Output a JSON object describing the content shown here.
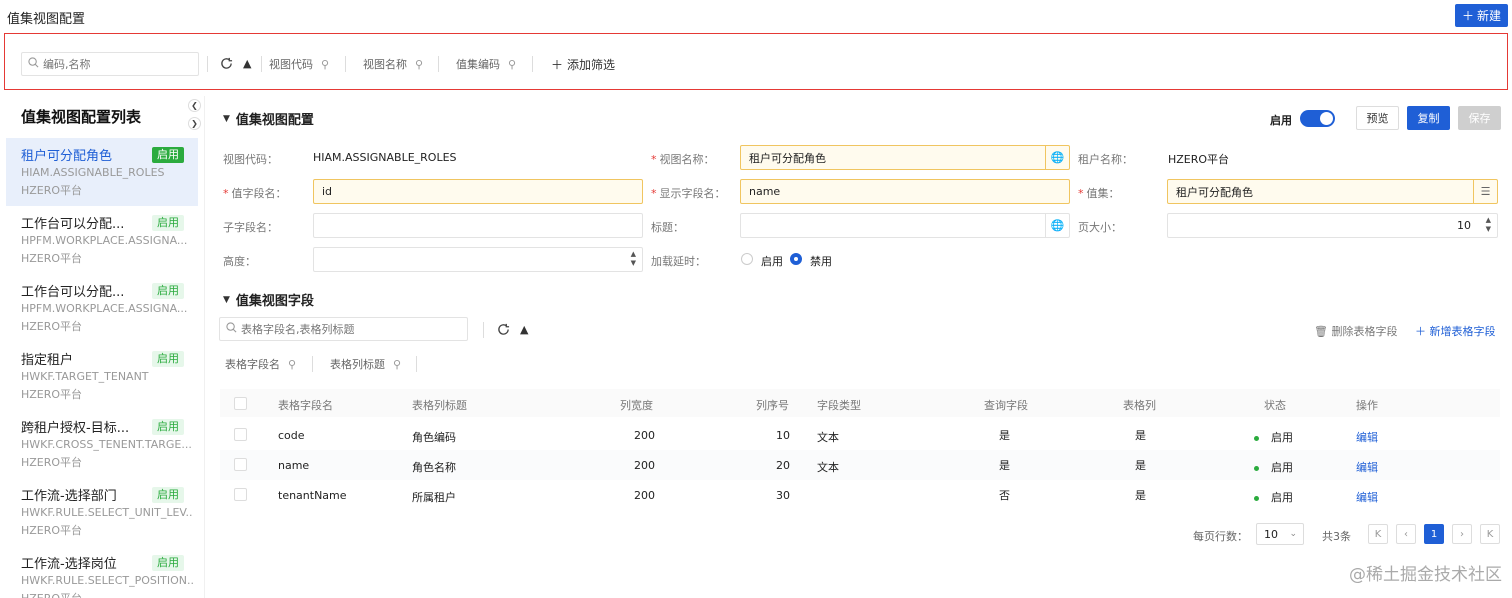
{
  "header": {
    "title": "值集视图配置",
    "new_label": "新建"
  },
  "filter": {
    "search_placeholder": "编码,名称",
    "fields": [
      "视图代码",
      "视图名称",
      "值集编码"
    ],
    "add_filter": "添加筛选"
  },
  "sidebar": {
    "title": "值集视图配置列表",
    "items": [
      {
        "name": "租户可分配角色",
        "code": "HIAM.ASSIGNABLE_ROLES",
        "tenant": "HZERO平台",
        "status": "启用"
      },
      {
        "name": "工作台可以分配...",
        "code": "HPFM.WORKPLACE.ASSIGNA...",
        "tenant": "HZERO平台",
        "status": "启用"
      },
      {
        "name": "工作台可以分配...",
        "code": "HPFM.WORKPLACE.ASSIGNA...",
        "tenant": "HZERO平台",
        "status": "启用"
      },
      {
        "name": "指定租户",
        "code": "HWKF.TARGET_TENANT",
        "tenant": "HZERO平台",
        "status": "启用"
      },
      {
        "name": "跨租户授权-目标...",
        "code": "HWKF.CROSS_TENENT.TARGE...",
        "tenant": "HZERO平台",
        "status": "启用"
      },
      {
        "name": "工作流-选择部门",
        "code": "HWKF.RULE.SELECT_UNIT_LEV...",
        "tenant": "HZERO平台",
        "status": "启用"
      },
      {
        "name": "工作流-选择岗位",
        "code": "HWKF.RULE.SELECT_POSITION...",
        "tenant": "HZERO平台",
        "status": "启用"
      }
    ]
  },
  "config": {
    "section_title": "值集视图配置",
    "enable_label": "启用",
    "preview_label": "预览",
    "copy_label": "复制",
    "save_label": "保存",
    "view_code_label": "视图代码：",
    "view_code": "HIAM.ASSIGNABLE_ROLES",
    "view_name_label": "视图名称：",
    "view_name": "租户可分配角色",
    "tenant_name_label": "租户名称：",
    "tenant_name": "HZERO平台",
    "value_field_label": "值字段名：",
    "value_field": "id",
    "display_field_label": "显示字段名：",
    "display_field": "name",
    "value_set_label": "值集：",
    "value_set": "租户可分配角色",
    "child_field_label": "子字段名：",
    "title_label": "标题：",
    "page_size_label": "页大小：",
    "page_size": "10",
    "height_label": "高度：",
    "lazy_label": "加载延时：",
    "lazy_on": "启用",
    "lazy_off": "禁用"
  },
  "fields_section": {
    "title": "值集视图字段",
    "search_placeholder": "表格字段名,表格列标题",
    "filters": [
      "表格字段名",
      "表格列标题"
    ],
    "delete_label": "删除表格字段",
    "add_label": "新增表格字段",
    "columns": [
      "表格字段名",
      "表格列标题",
      "列宽度",
      "列序号",
      "字段类型",
      "查询字段",
      "表格列",
      "状态",
      "操作"
    ],
    "rows": [
      {
        "field": "code",
        "title": "角色编码",
        "width": "200",
        "order": "10",
        "type": "文本",
        "query": "是",
        "column": "是",
        "status": "启用",
        "action": "编辑"
      },
      {
        "field": "name",
        "title": "角色名称",
        "width": "200",
        "order": "20",
        "type": "文本",
        "query": "是",
        "column": "是",
        "status": "启用",
        "action": "编辑"
      },
      {
        "field": "tenantName",
        "title": "所属租户",
        "width": "200",
        "order": "30",
        "type": "",
        "query": "否",
        "column": "是",
        "status": "启用",
        "action": "编辑"
      }
    ]
  },
  "pagination": {
    "per_page_label": "每页行数：",
    "per_page": "10",
    "total": "共3条",
    "current": "1"
  },
  "watermark": "@稀土掘金技术社区"
}
